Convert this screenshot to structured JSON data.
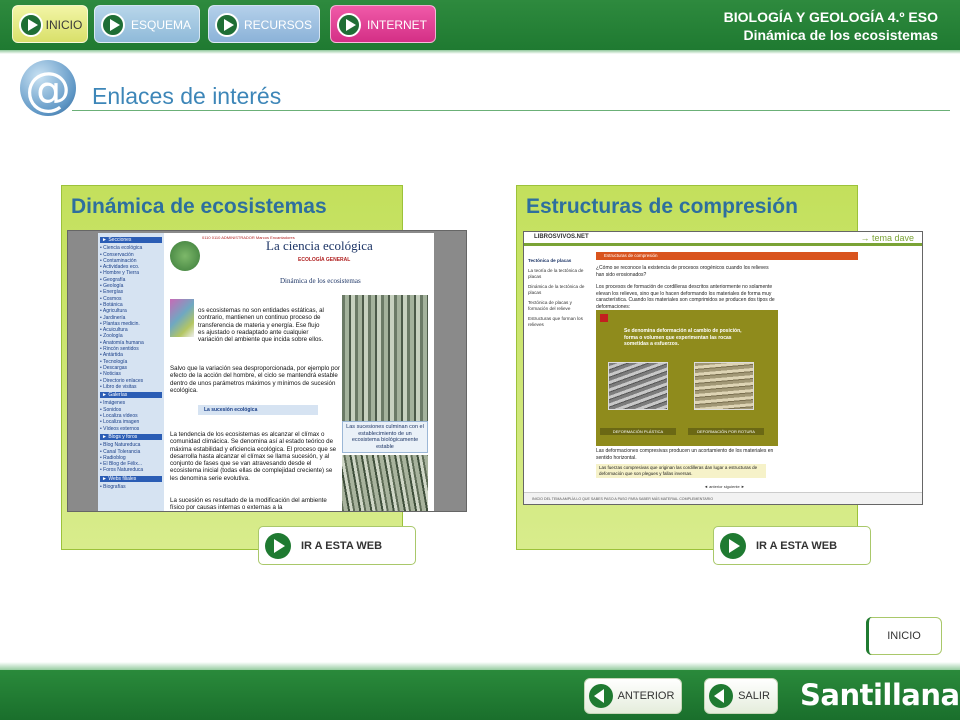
{
  "nav": {
    "items": [
      {
        "label": "INICIO"
      },
      {
        "label": "ESQUEMA"
      },
      {
        "label": "RECURSOS"
      },
      {
        "label": "INTERNET"
      }
    ]
  },
  "header": {
    "title_line1": "BIOLOGÍA Y GEOLOGÍA 4.º ESO",
    "title_line2": "Dinámica de los ecosistemas"
  },
  "page": {
    "icon": "at-sign-icon",
    "title": "Enlaces de interés"
  },
  "cards": [
    {
      "title": "Dinámica de ecosistemas",
      "button_label": "IR A ESTA WEB",
      "screenshot": {
        "site_title": "La ciencia ecológica",
        "header_red": "0110 0110 ADMINISTRADOR Marcos Encantadores",
        "section_label": "ECOLOGÍA GENERAL",
        "page_heading": "Dinámica de los ecosistemas",
        "side_items": [
          "► Secciones",
          "• Ciencia ecológica",
          "• Conservación",
          "• Contaminación",
          "• Actividades eco.",
          "• Hombre y Tierra",
          "• Geografía",
          "• Geología",
          "• Energías",
          "• Cosmos",
          "• Botánica",
          "• Agricultura",
          "• Jardinería",
          "• Plantas medicin.",
          "• Acuicultura",
          "• Zoología",
          "• Anatomía humana",
          "• Rincón sentidos",
          "• Antártida",
          "• Tecnología",
          "• Descargas",
          "• Noticias",
          "• Directorio enlaces",
          "• Libro de visitas",
          "► Galerías",
          "• Imágenes",
          "• Sonidos",
          "• Localiza vídeos",
          "• Localiza imagen",
          "• Vídeos externos",
          "► Blogs y foros",
          "• Blog Natureduca",
          "• Canal Tolerancia",
          "• Radioblog",
          "• El Blog de Félix...",
          "• Foros Natureduca",
          "► Webs filiales",
          "• Biografías"
        ],
        "para1": "os ecosistemas no son entidades estáticas, al contrario, mantienen un continuo proceso de transferencia de materia y energía. Ese flujo es ajustado o readaptado ante cualquier variación del ambiente que incida sobre ellos.",
        "para2": "Salvo que la variación sea desproporcionada, por ejemplo por efecto de la acción del hombre, el ciclo se mantendrá estable dentro de unos parámetros máximos y mínimos de sucesión ecológica.",
        "subheading": "La sucesión ecológica",
        "para3": "La tendencia de los ecosistemas es alcanzar el clímax o comunidad climácica. Se denomina así al estado teórico de máxima estabilidad y eficiencia ecológica. El proceso que se desarrolla hasta alcanzar el clímax se llama sucesión, y al conjunto de fases que se van atravesando desde el ecosistema inicial (todas ellas de complejidad creciente) se les denomina serie evolutiva.",
        "para4": "La sucesión es resultado de la modificación del ambiente físico por causas internas o externas a la",
        "caption": "Las sucesiones culminan con el establecimiento de un ecosistema biológicamente estable"
      }
    },
    {
      "title": "Estructuras de compresión",
      "button_label": "IR A ESTA WEB",
      "screenshot": {
        "brand_left": "LIBROSVIVOS.NET",
        "brand_right": "→ tema dave",
        "orange_bar": "Estructuras de compresión",
        "left_items": [
          "Tectónica de placas",
          "La teoría de la tectónica de placas",
          "Dinámica de la tectónica de placas",
          "Tectónica de placas y formación del relieve",
          "Estructuras que forman los relieves"
        ],
        "question": "¿Cómo se reconoce la existencia de procesos orogénicos cuando los relieves han sido erosionados?",
        "para2": "Los procesos de formación de cordilleras descritos anteriormente no solamente elevan los relieves, sino que lo hacen deformando los materiales de forma muy característica. Cuando los materiales son comprimidos se producen dos tipos de deformaciones:",
        "box_text": "Se denomina deformación al cambio de posición, forma o volumen que experimentan las rocas sometidas a esfuerzos.",
        "label1": "DEFORMACIÓN PLÁSTICA",
        "label2": "DEFORMACIÓN POR ROTURA",
        "para3": "Las deformaciones compresivas producen un acortamiento de los materiales en sentido horizontal.",
        "para4": "Las fuerzas compresivas que originan las cordilleras dan lugar a estructuras de deformación que son plegues y fallas inversas.",
        "nav": "◄ anterior   siguiente ►",
        "bottom": "INICIO DEL TEMA   AMPLÍA LO QUE SABES   PASO A PASO   PARA SABER MÁS   MATERIAL COMPLEMENTARIO"
      }
    }
  ],
  "bottom_inicio": "INICIO",
  "footer": {
    "prev_label": "ANTERIOR",
    "exit_label": "SALIR",
    "brand": "Santillana"
  },
  "colors": {
    "header_green": "#1f7a31",
    "card_green": "#c3e05c",
    "title_blue": "#3d86b8",
    "internet_pink": "#d42f86"
  }
}
